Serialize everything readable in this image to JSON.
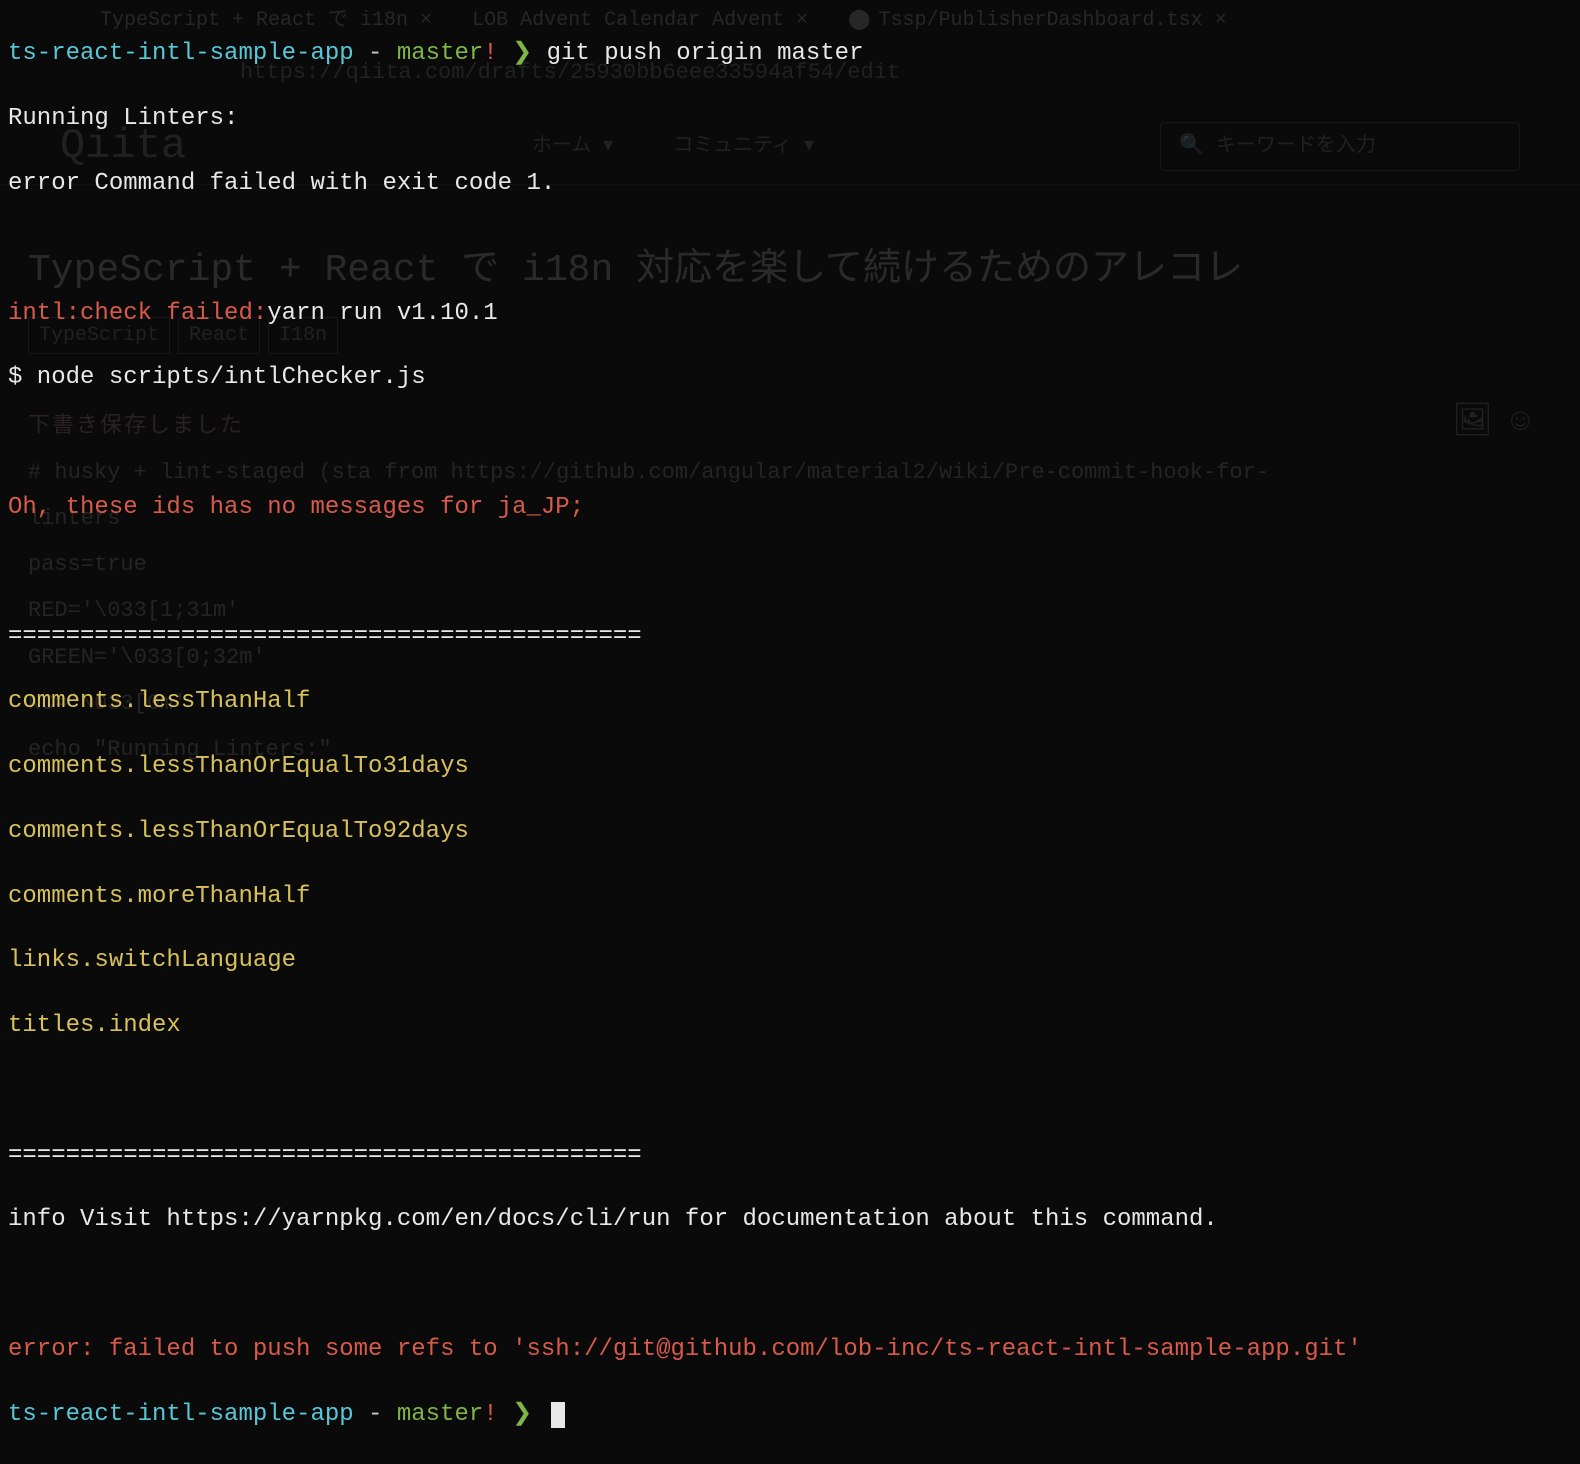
{
  "prompt1": {
    "repo": "ts-react-intl-sample-app",
    "sep": " - ",
    "branch": "master",
    "dirty": "! ",
    "arrow": "❯ ",
    "command": "git push origin master"
  },
  "output": {
    "running_linters": "Running Linters:",
    "error_exit": "error Command failed with exit code 1.",
    "intl_check_failed": "intl:check failed:",
    "yarn_run": "yarn run v1.10.1",
    "node_cmd": "$ node scripts/intlCheсker.js",
    "no_messages": "Oh, these ids has no messages for ja_JP;",
    "divider": "============================================",
    "ids": [
      "comments.lessThanHalf",
      "comments.lessThanOrEqualTo31days",
      "comments.lessThanOrEqualTo92days",
      "comments.moreThanHalf",
      "links.switchLanguage",
      "titles.index"
    ],
    "info_visit": "info Visit https://yarnpkg.com/en/docs/cli/run for documentation about this command.",
    "push_error": "error: failed to push some refs to 'ssh://git@github.com/lob-inc/ts-react-intl-sample-app.git'"
  },
  "prompt2": {
    "repo": "ts-react-intl-sample-app",
    "sep": " - ",
    "branch": "master",
    "dirty": "! ",
    "arrow": "❯ "
  },
  "background": {
    "tabs": [
      "TypeScript + React で i18n ×",
      "LOB Advent Calendar Advent   ×",
      "Tssp/PublisherDashboard.tsx  ×"
    ],
    "url": "https://qiita.com/drafts/25930bb6eee33594af54/edit",
    "logo": "Qiita",
    "nav": [
      "ホーム ▾",
      "コミュニティ ▾"
    ],
    "search_placeholder": "キーワードを入力",
    "title": "TypeScript + React で i18n 対応を楽して続けるためのアレコレ",
    "tags": [
      "TypeScript",
      "React",
      "I18n"
    ],
    "content_lines": [
      "下書き保存しました",
      "# husky + lint-staged (sta  from https://github.com/angular/material2/wiki/Pre-commit-hook-for-",
      "linters",
      "",
      "pass=true",
      "RED='\\033[1;31m'",
      "GREEN='\\033[0;32m'",
      "NC='\\033[0m'",
      "",
      "echo \"Running Linters:\""
    ]
  }
}
